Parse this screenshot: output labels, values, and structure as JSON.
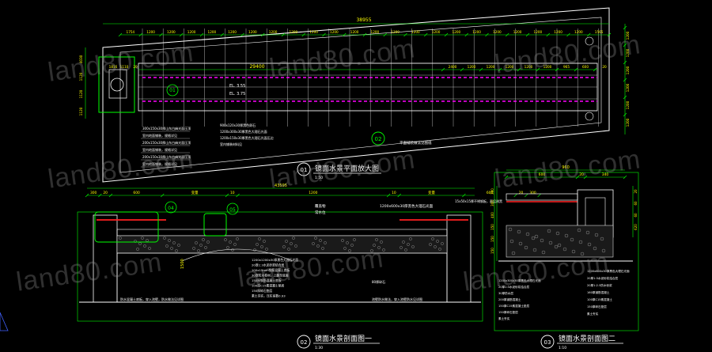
{
  "colors": {
    "background": "#000000",
    "line": "#ffffff",
    "dimension": "#00ff00",
    "annotation": "#ffff00",
    "accent_red": "#ff2020",
    "accent_magenta": "#ff00ff",
    "accent_cyan": "#00ffff",
    "highlight_box": "#00ff00"
  },
  "plan": {
    "top_dims": [
      "1754",
      "1200",
      "1200",
      "1200",
      "1200",
      "1200",
      "1200",
      "1200",
      "1200",
      "1200",
      "1200",
      "1200",
      "1200",
      "1200",
      "1200",
      "1200",
      "1200",
      "1200",
      "1200",
      "1200",
      "1200",
      "1200",
      "1200",
      "1565"
    ],
    "overall_top": "38955",
    "mid_dim_left": "29400",
    "mid_dims_right": [
      "2400",
      "1200",
      "1200",
      "1200",
      "1200",
      "1200",
      "965",
      "600",
      "20"
    ],
    "left_dims": [
      "1816",
      "1110",
      "20"
    ],
    "right_dims": [
      "1200",
      "1200",
      "1200",
      "1200",
      "1200",
      "1200"
    ],
    "left_vertical": [
      "4030",
      "1120",
      "1120",
      "1120"
    ],
    "level_labels": [
      "EL. 3.55",
      "EL. 3.75"
    ],
    "callout_01": "01",
    "callout_02": "02",
    "notes_left": [
      "300x150x30厚山东白麻光面压顶",
      "室内地面铺装，规格详见",
      "200x150x30厚山东白麻光面压顶",
      "室内地面铺装，规格详见",
      "200x150x30厚山东白麻光面压顶",
      "室内地面铺装，规格详见"
    ],
    "notes_mid": [
      "900x120x30厚黑色卵石",
      "1200x300x30厚黑色大理石光面",
      "1200x150x30厚黑色大理石光面压边",
      "室内铺装材料见"
    ],
    "note_right": "平面铺装做法见图纸",
    "title": "镜面水景平面放大图",
    "scale": "1:50",
    "title_number": "01"
  },
  "section1": {
    "top_dims": [
      "300",
      "20",
      "600",
      "变量",
      "10",
      "1200",
      "10",
      "变量",
      "600",
      "20",
      "300"
    ],
    "overall": "43595",
    "callouts": [
      "04",
      "05"
    ],
    "labels_top": [
      "覆盖物",
      "常水位"
    ],
    "note_right_top": "1200x600x30厚黑色大理石光面",
    "note_far_right": "15x50x15厚不锈钢板，面层刷黑",
    "notes_bottom": [
      "1200x1200x30厚黑色大理石光面",
      "20厚1:3水泥砂浆结合层",
      "100x15mm钢筋混凝土底板",
      "30厚防水卷材，上翻至底面",
      "150厚钢筋混凝土底板",
      "100厚C15素混凝土垫层",
      "150厚碎石垫层",
      "素土夯实，压实系数0.93"
    ],
    "note_left_bottom": "防水混凝土底板，穿入池壁，防水做法见详图",
    "note_right_bottom": "池壁防水做法，穿入池壁防水见详图",
    "dim_vertical": "1500",
    "small_label": "80厚碎石",
    "title": "镜面水景剖面图一",
    "scale": "1:30",
    "title_number": "02"
  },
  "section2": {
    "top_overall": "960",
    "top_dims": [
      "600",
      "20",
      "340"
    ],
    "vertical_left": [
      "300",
      "300",
      "400",
      "150",
      "150",
      "150"
    ],
    "vertical_right": [
      "20",
      "60",
      "60",
      "620"
    ],
    "notes_left": [
      "1200x300x30厚黑色大理石光面",
      "20厚1:3水泥砂浆结合层",
      "30厚防水层",
      "200厚钢筋混凝土",
      "150厚C15素混凝土垫层",
      "150厚碎石垫层",
      "素土夯实"
    ],
    "notes_right": [
      "1200x600x30厚黑色大理石光面",
      "20厚1:3水泥砂浆结合层",
      "20厚1:2.5防水砂浆",
      "160厚钢筋混凝土",
      "100厚C15素混凝土",
      "150厚碎石垫层",
      "素土夯实"
    ],
    "title": "镜面水景剖面图二",
    "scale": "1:10",
    "title_number": "03"
  },
  "watermark": "land80.com"
}
